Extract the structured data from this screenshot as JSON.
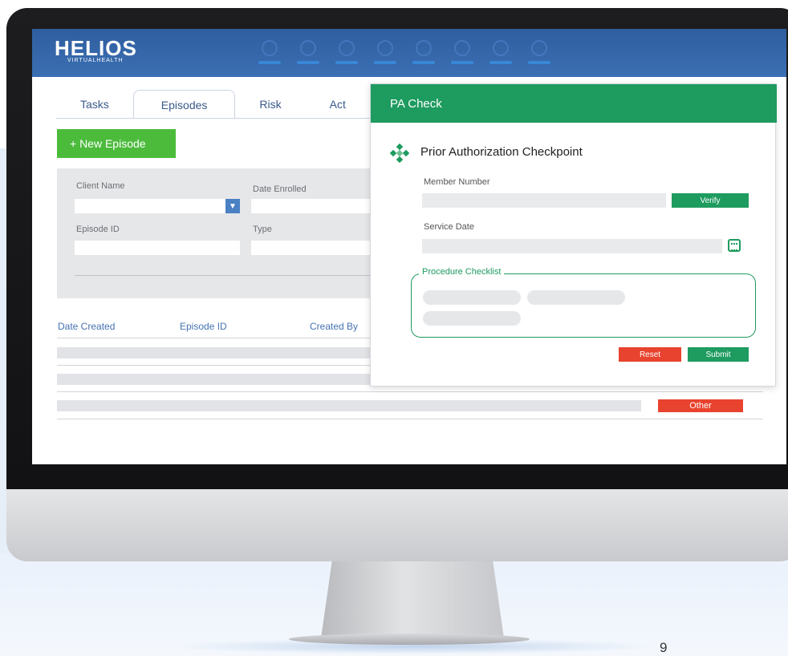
{
  "app": {
    "brand": "HELIOS",
    "brand_sub": "VIRTUALHEALTH",
    "accent": "#2f5e9f",
    "green": "#1e9b5f"
  },
  "tabs": [
    {
      "label": "Tasks"
    },
    {
      "label": "Episodes",
      "active": true
    },
    {
      "label": "Risk"
    },
    {
      "label": "Act"
    }
  ],
  "toolbar": {
    "new_episode_label": "+ New Episode"
  },
  "filters": {
    "client_name_label": "Client Name",
    "date_enrolled_label": "Date Enrolled",
    "episode_id_label": "Episode ID",
    "type_label": "Type"
  },
  "table": {
    "columns": [
      "Date Created",
      "Episode ID",
      "Created By"
    ],
    "row3_badge": "Other"
  },
  "modal": {
    "title": "PA Check",
    "heading": "Prior Authorization Checkpoint",
    "member_number_label": "Member Number",
    "verify_label": "Verify",
    "service_date_label": "Service Date",
    "checklist_label": "Procedure Checklist",
    "reset_label": "Reset",
    "submit_label": "Submit"
  },
  "page_number": "9"
}
